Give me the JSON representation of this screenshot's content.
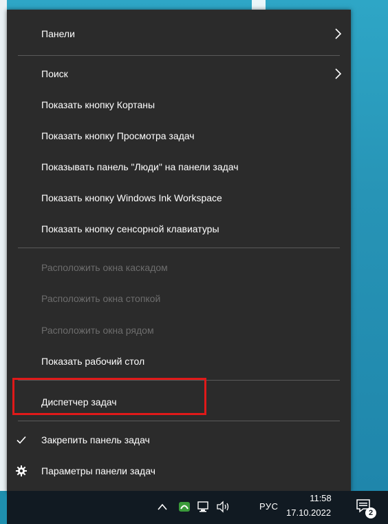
{
  "menu": {
    "toolbars": "Панели",
    "search": "Поиск",
    "show_cortana": "Показать кнопку Кортаны",
    "show_task_view": "Показать кнопку Просмотра задач",
    "show_people": "Показывать панель \"Люди\" на панели задач",
    "show_ink_workspace": "Показать кнопку Windows Ink Workspace",
    "show_touch_keyboard": "Показать кнопку сенсорной клавиатуры",
    "cascade_windows": "Расположить окна каскадом",
    "stack_windows": "Расположить окна стопкой",
    "side_by_side_windows": "Расположить окна рядом",
    "show_desktop": "Показать рабочий стол",
    "task_manager": "Диспетчер задач",
    "lock_taskbar": "Закрепить панель задач",
    "taskbar_settings": "Параметры панели задач"
  },
  "icons": {
    "submenu": "chevron-right-icon",
    "checked": "checkmark-icon",
    "settings": "gear-icon"
  },
  "taskbar": {
    "language": "РУС",
    "time": "11:58",
    "date": "17.10.2022",
    "notification_count": "2"
  },
  "colors": {
    "menu_background": "#2b2b2b",
    "menu_text": "#ffffff",
    "disabled_text": "#6d6d6d",
    "highlight_border": "#e01919",
    "taskbar_background": "#111a22",
    "desktop": "#2794b6"
  }
}
